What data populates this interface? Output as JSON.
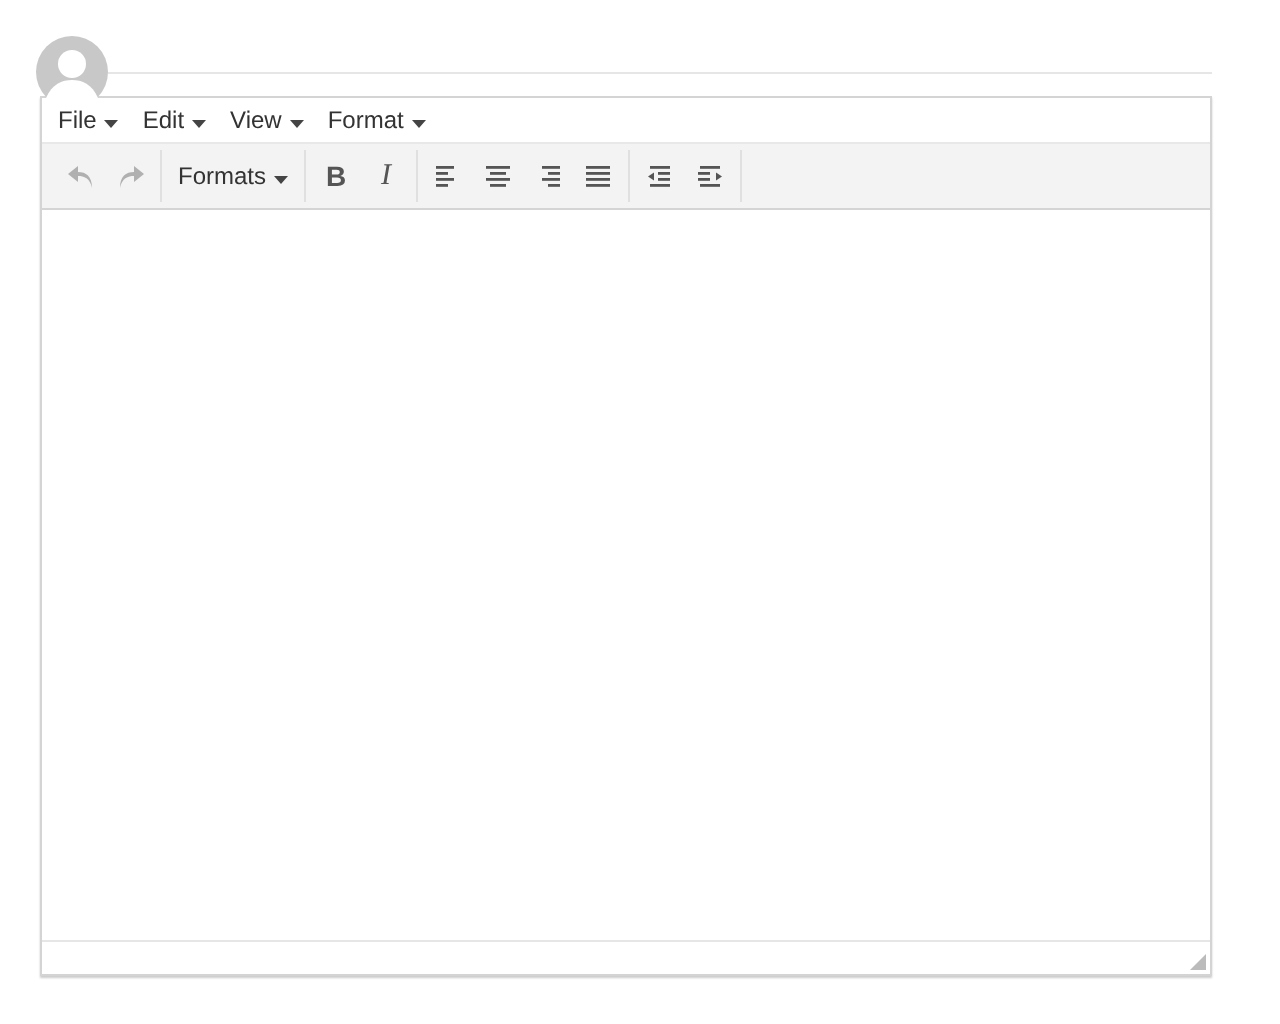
{
  "menubar": [
    {
      "label": "File"
    },
    {
      "label": "Edit"
    },
    {
      "label": "View"
    },
    {
      "label": "Format"
    }
  ],
  "toolbar": [
    [
      {
        "kind": "undo",
        "disabled": true
      },
      {
        "kind": "redo",
        "disabled": true
      }
    ],
    [
      {
        "kind": "dropdown",
        "label": "Formats",
        "disabled": false
      }
    ],
    [
      {
        "kind": "bold",
        "label": "B",
        "disabled": false
      },
      {
        "kind": "italic",
        "label": "I",
        "disabled": false
      }
    ],
    [
      {
        "kind": "align-left",
        "disabled": false
      },
      {
        "kind": "align-center",
        "disabled": false
      },
      {
        "kind": "align-right",
        "disabled": false
      },
      {
        "kind": "justify",
        "disabled": false
      }
    ],
    [
      {
        "kind": "outdent",
        "disabled": false
      },
      {
        "kind": "indent",
        "disabled": false
      }
    ]
  ]
}
